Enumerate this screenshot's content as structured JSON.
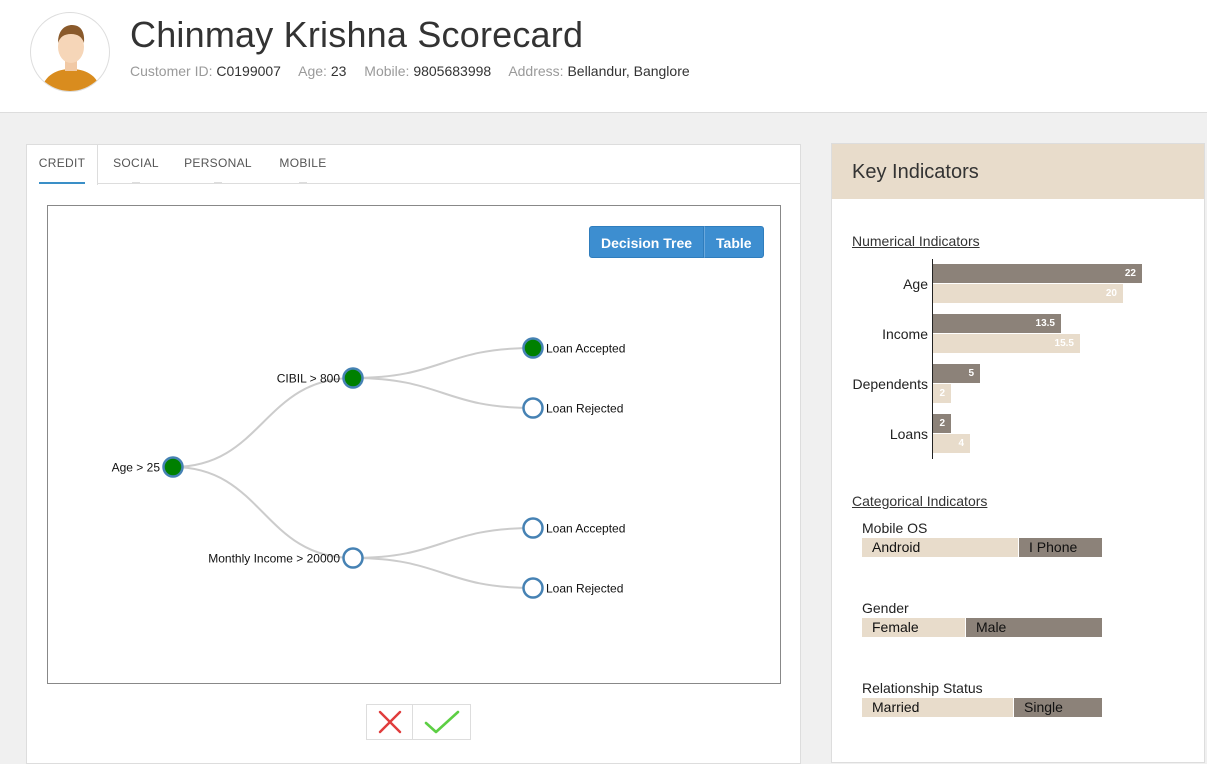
{
  "header": {
    "title": "Chinmay Krishna Scorecard",
    "customer_id_label": "Customer ID:",
    "customer_id": "C0199007",
    "age_label": "Age:",
    "age": "23",
    "mobile_label": "Mobile:",
    "mobile": "9805683998",
    "address_label": "Address:",
    "address": "Bellandur, Banglore"
  },
  "tabs": [
    {
      "label": "CREDIT",
      "active": true
    },
    {
      "label": "SOCIAL",
      "active": false
    },
    {
      "label": "PERSONAL",
      "active": false
    },
    {
      "label": "MOBILE",
      "active": false
    }
  ],
  "view_toggle": {
    "decision_tree": "Decision Tree",
    "table": "Table"
  },
  "tree": {
    "root": "Age > 25",
    "branch1": "CIBIL > 800",
    "branch2": "Monthly Income > 20000",
    "leaf1": "Loan Accepted",
    "leaf2": "Loan Rejected",
    "leaf3": "Loan Accepted",
    "leaf4": "Loan Rejected"
  },
  "actions": {
    "reject_icon": "close-icon",
    "accept_icon": "check-icon"
  },
  "key_indicators": {
    "title": "Key Indicators",
    "numerical_title": "Numerical Indicators",
    "numerical": [
      {
        "label": "Age",
        "current": "22",
        "reference": "20"
      },
      {
        "label": "Income",
        "current": "13.5",
        "reference": "15.5"
      },
      {
        "label": "Dependents",
        "current": "5",
        "reference": "2"
      },
      {
        "label": "Loans",
        "current": "2",
        "reference": "4"
      }
    ],
    "categorical_title": "Categorical Indicators",
    "categorical": [
      {
        "label": "Mobile OS",
        "left": "Android",
        "right": "I Phone"
      },
      {
        "label": "Gender",
        "left": "Female",
        "right": "Male"
      },
      {
        "label": "Relationship Status",
        "left": "Married",
        "right": "Single"
      }
    ]
  },
  "colors": {
    "accent": "#3d8ed0",
    "node_filled": "#008000",
    "node_stroke": "#4682b4",
    "bar_current": "#8c8279",
    "bar_reference": "#e8dccb"
  }
}
